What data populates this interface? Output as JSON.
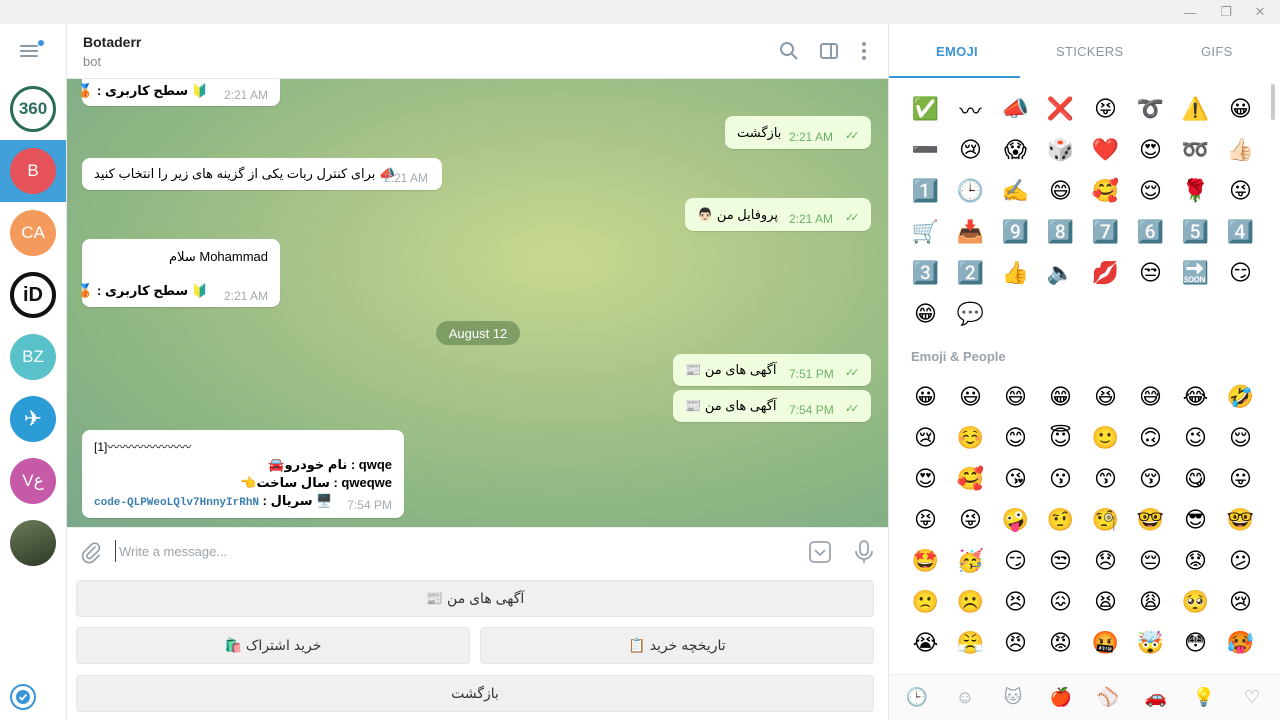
{
  "window": {
    "minimize": "—",
    "maximize": "❐",
    "close": "✕"
  },
  "chats": [
    {
      "initials": "360",
      "color": "#2b6d5a"
    },
    {
      "initials": "B",
      "color": "#e5525a"
    },
    {
      "initials": "CA",
      "color": "#f49a5d"
    },
    {
      "initials": "iD",
      "color": "#111111"
    },
    {
      "initials": "BZ",
      "color": "#59c1c9"
    },
    {
      "initials": "✈",
      "color": "#2b9bd6"
    },
    {
      "initials": "Vع",
      "color": "#c75aa8"
    },
    {
      "initials": "",
      "color": "#4a5a3a"
    }
  ],
  "header": {
    "name": "Botaderr",
    "status": "bot"
  },
  "messages": {
    "m1": {
      "text": "🥉 : سطح کاربری 🔰",
      "time": "2:21 AM"
    },
    "m2": {
      "text": "بازگشت",
      "time": "2:21 AM"
    },
    "m3": {
      "text": "برای کنترل ربات یکی از گزینه های زیر را انتخاب کنید 📣",
      "time": "2:21 AM"
    },
    "m4": {
      "text": "👨🏻 پروفایل من",
      "time": "2:21 AM"
    },
    "m5": {
      "line1": "سلام Mohammad",
      "line2": "🥉 : سطح کاربری 🔰",
      "time": "2:21 AM"
    },
    "date": "August 12",
    "m6": {
      "text": "📰 آگهی های من",
      "time": "7:51 PM"
    },
    "m7": {
      "text": "📰 آگهی های من",
      "time": "7:54 PM"
    },
    "m8": {
      "line1": "[1]〰〰〰〰〰〰〰",
      "line2": "🚘نام خودرو : qwqe",
      "line3": "👈سال ساخت : qweqwe",
      "line4a": "code-QLPWeoLQlv7HnnyIrRhN",
      "line4b": " : سریال 🖥️",
      "time": "7:54 PM"
    }
  },
  "composer": {
    "placeholder": "Write a message..."
  },
  "keyboard": {
    "btn1": "📰 آگهی های من",
    "btn2": "🛍️ خرید اشتراک",
    "btn3": "📋 تاریخچه خرید",
    "btn4": "بازگشت"
  },
  "emoji": {
    "tabs": [
      "EMOJI",
      "STICKERS",
      "GIFS"
    ],
    "recent": [
      "✅",
      "〰",
      "📣",
      "❌",
      "😝",
      "➰",
      "⚠️",
      "😀",
      "➖",
      "😢",
      "😱",
      "🎲",
      "❤️",
      "😍",
      "➿",
      "👍🏻",
      "1️⃣",
      "🕒",
      "✍️",
      "😄",
      "🥰",
      "😌",
      "🌹",
      "😜",
      "🛒",
      "📥",
      "9️⃣",
      "8️⃣",
      "7️⃣",
      "6️⃣",
      "5️⃣",
      "4️⃣",
      "3️⃣",
      "2️⃣",
      "👍",
      "🔈",
      "💋",
      "😒",
      "🔜",
      "😏",
      "😁",
      "💬"
    ],
    "section": "Emoji & People",
    "people": [
      "😀",
      "😃",
      "😄",
      "😁",
      "😆",
      "😅",
      "😂",
      "🤣",
      "😢",
      "☺️",
      "😊",
      "😇",
      "🙂",
      "🙃",
      "😉",
      "😌",
      "😍",
      "🥰",
      "😘",
      "😗",
      "😙",
      "😚",
      "😋",
      "😛",
      "😝",
      "😜",
      "🤪",
      "🤨",
      "🧐",
      "🤓",
      "😎",
      "🤓",
      "🤩",
      "🥳",
      "😏",
      "😒",
      "😞",
      "😔",
      "😟",
      "😕",
      "🙁",
      "☹️",
      "😣",
      "😖",
      "😫",
      "😩",
      "🥺",
      "😢",
      "😭",
      "😤",
      "😠",
      "😡",
      "🤬",
      "🤯",
      "😳",
      "🥵"
    ],
    "bottom": [
      "🕒",
      "☺",
      "🐱",
      "🍎",
      "⚾",
      "🚗",
      "💡",
      "♡"
    ]
  }
}
